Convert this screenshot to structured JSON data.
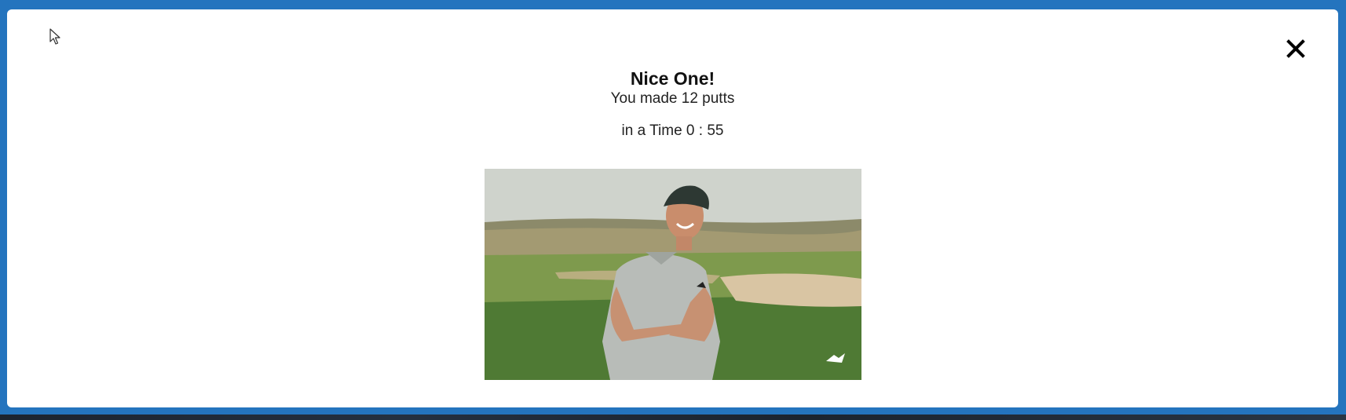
{
  "modal": {
    "title": "Nice One!",
    "putts_text": "You made 12 putts",
    "time_text": "in a Time 0 : 55"
  },
  "icons": {
    "close": "close-icon",
    "cursor": "mouse-pointer-icon"
  },
  "colors": {
    "frame_blue": "#2474be",
    "modal_bg": "#ffffff",
    "text": "#111111"
  }
}
